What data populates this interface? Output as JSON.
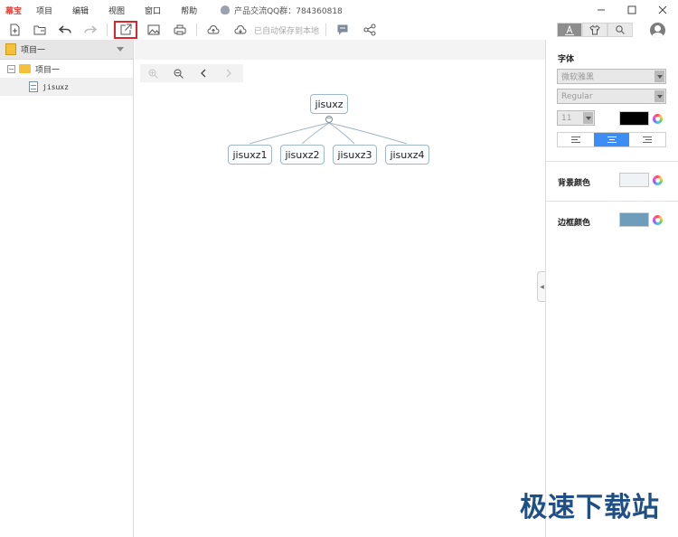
{
  "titlebar": {
    "app_name": "幕宝",
    "menu": [
      "项目",
      "编辑",
      "视图",
      "窗口",
      "帮助"
    ],
    "qq_group": "产品交流QQ群：784360818"
  },
  "toolbar": {
    "autosave": "已自动保存到本地"
  },
  "sidebar": {
    "header": "项目一",
    "tree": {
      "folder": "项目一",
      "file": "jisuxz"
    }
  },
  "canvas": {
    "root": "jisuxz",
    "collapse_symbol": "−",
    "children": [
      "jisuxz1",
      "jisuxz2",
      "jisuxz3",
      "jisuxz4"
    ]
  },
  "panel": {
    "font_title": "字体",
    "font_family": "微软雅黑",
    "font_style": "Regular",
    "font_size": "11",
    "font_color": "#000000",
    "bg_label": "背景颜色",
    "bg_color": "#f0f3f6",
    "border_label": "边框颜色",
    "border_color": "#6e9dbc"
  },
  "watermark": "极速下载站"
}
